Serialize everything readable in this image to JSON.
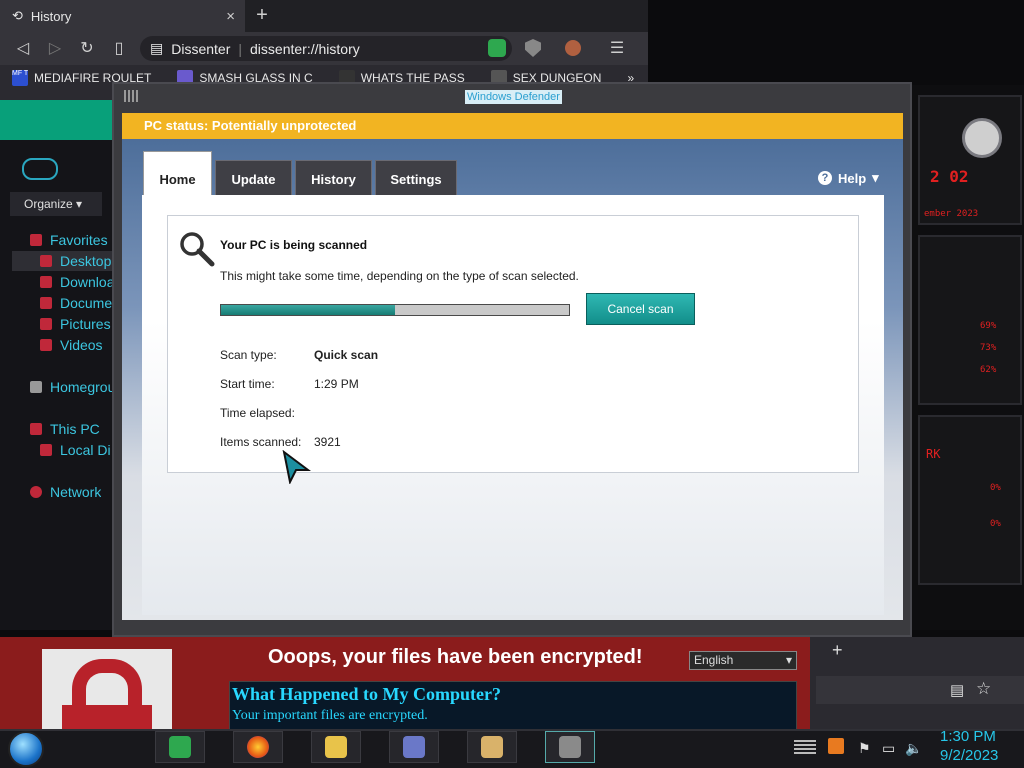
{
  "browser": {
    "tab_title": "History",
    "tab_close": "×",
    "new_tab": "+",
    "site_name": "Dissenter",
    "url": "dissenter://history",
    "bookmarks": [
      {
        "icon_text": "MF T",
        "label": "MEDIAFIRE ROULET"
      },
      {
        "icon_text": "",
        "label": "SMASH GLASS IN C"
      },
      {
        "icon_text": "",
        "label": "WHATS THE PASS"
      },
      {
        "icon_text": "",
        "label": "SEX DUNGEON"
      },
      {
        "icon_text": "",
        "label": "»"
      }
    ]
  },
  "explorer": {
    "organize": "Organize",
    "items": [
      {
        "label": "Favorites"
      },
      {
        "label": "Desktop"
      },
      {
        "label": "Downloa"
      },
      {
        "label": "Docume"
      },
      {
        "label": "Pictures"
      },
      {
        "label": "Videos"
      },
      {
        "label": "Homegrou"
      },
      {
        "label": "This PC"
      },
      {
        "label": "Local Di"
      },
      {
        "label": "Network"
      }
    ]
  },
  "hud": {
    "lines": [
      "2 02",
      "ember 2023",
      "69%",
      "73%",
      "62%",
      "RK",
      "0%",
      "0%"
    ]
  },
  "defender": {
    "title": "Windows Defender",
    "status": "PC status: Potentially unprotected",
    "tabs": [
      "Home",
      "Update",
      "History",
      "Settings"
    ],
    "help": "Help",
    "scan_title": "Your PC is being scanned",
    "scan_sub": "This might take some time, depending on the type of scan selected.",
    "progress_fraction": 0.5,
    "cancel": "Cancel scan",
    "rows": [
      {
        "label": "Scan type:",
        "value": "Quick scan"
      },
      {
        "label": "Start time:",
        "value": "1:29 PM"
      },
      {
        "label": "Time elapsed:",
        "value": ""
      },
      {
        "label": "Items scanned:",
        "value": "3921"
      }
    ]
  },
  "ransom": {
    "title": "Ooops, your files have been encrypted!",
    "language": "English",
    "heading": "What Happened to My Computer?",
    "sub": "Your important files are encrypted."
  },
  "taskbar": {
    "time": "1:30 PM",
    "date": "9/2/2023"
  },
  "colors": {
    "status_bar": "#f2b422",
    "accent_teal": "#128e8a",
    "ransom_red": "#8b1c1c",
    "clock_cyan": "#27c6e8"
  }
}
